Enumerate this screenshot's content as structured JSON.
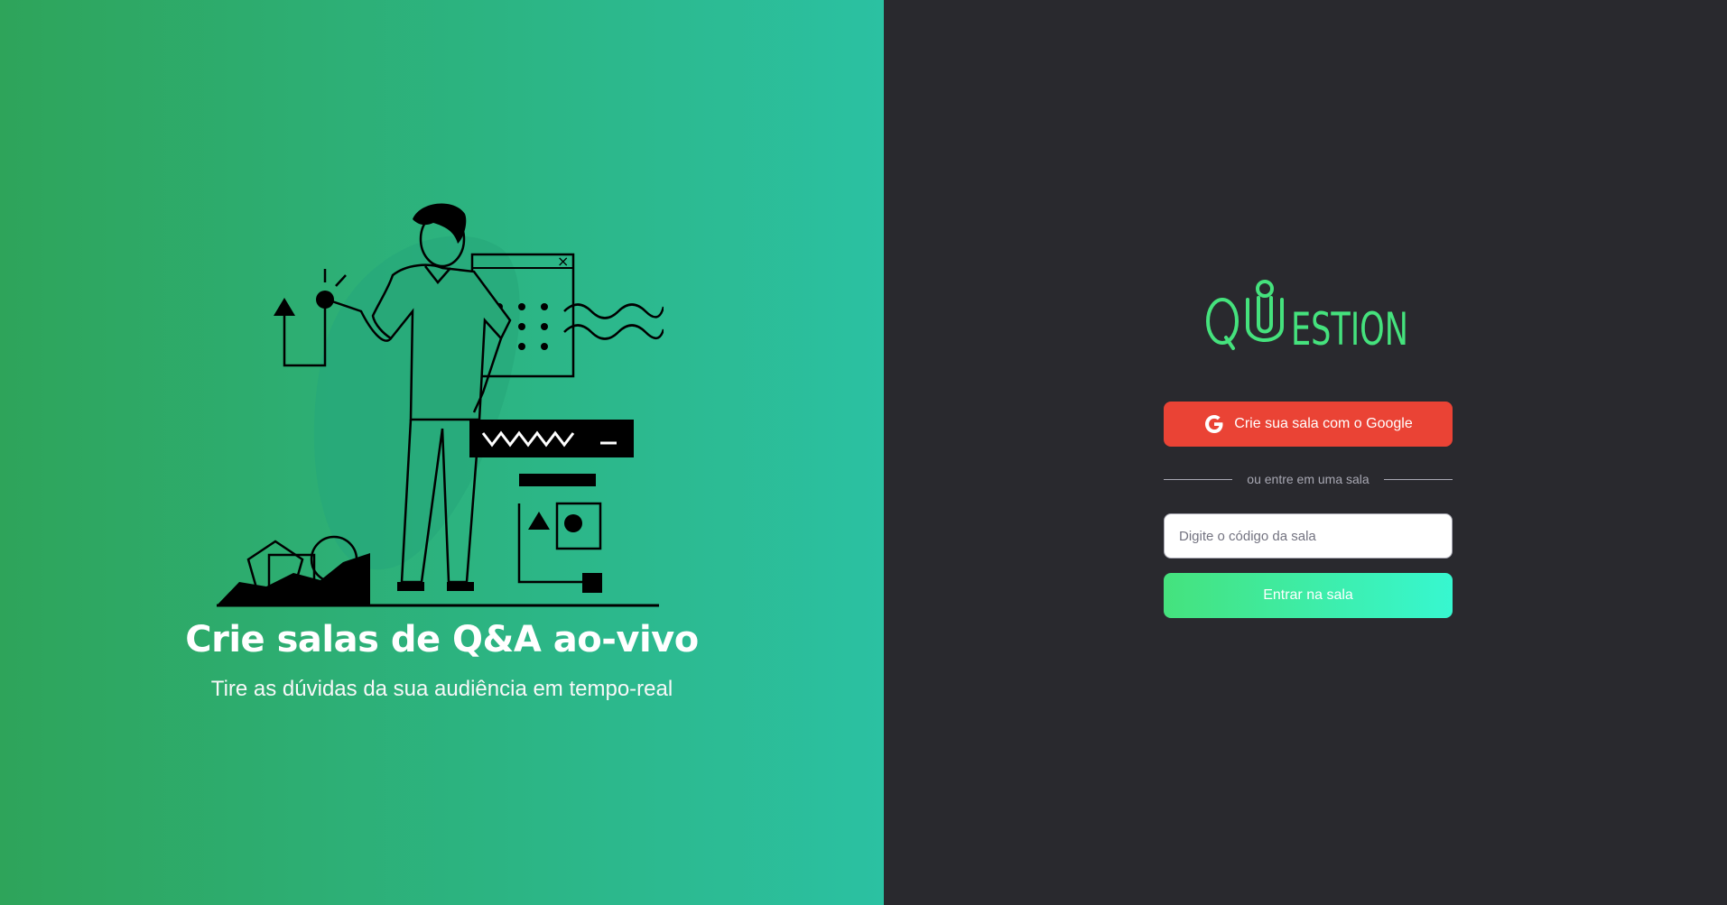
{
  "aside": {
    "title": "Crie salas de Q&A ao-vivo",
    "subtitle": "Tire as dúvidas da sua audiência em tempo-real",
    "illustration_icon": "person-with-ideas-illustration",
    "gradient": [
      "#2ea45a",
      "#2bc1a2"
    ]
  },
  "main": {
    "logo_text": "QUESTION",
    "logo_color": "#45e27d",
    "google_button": {
      "label": "Crie sua sala com o Google",
      "icon": "google-icon",
      "color": "#ea4335"
    },
    "separator_text": "ou entre em uma sala",
    "room_input": {
      "placeholder": "Digite o código da sala",
      "value": ""
    },
    "enter_button": {
      "label": "Entrar na sala",
      "gradient": [
        "#45e27d",
        "#37f7d0"
      ]
    },
    "background": "#29292e"
  }
}
